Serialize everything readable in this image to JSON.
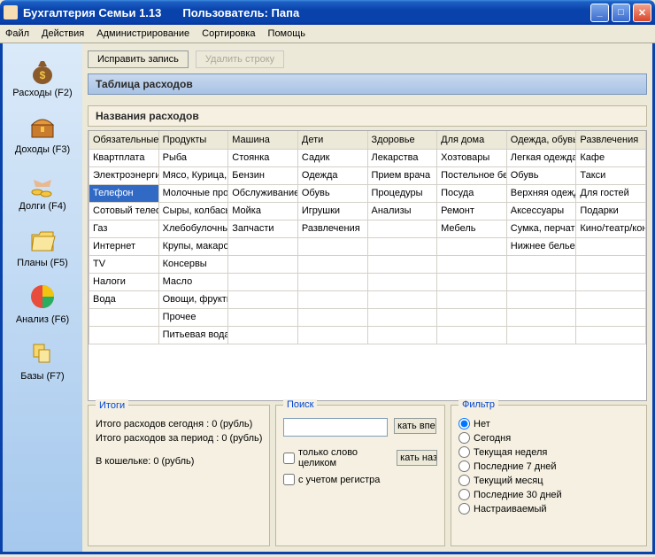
{
  "window": {
    "title": "Бухгалтерия Семьи 1.13",
    "user_prefix": "Пользователь:",
    "user_name": "Папа"
  },
  "menu": [
    "Файл",
    "Действия",
    "Администрирование",
    "Сортировка",
    "Помощь"
  ],
  "sidebar": [
    {
      "label": "Расходы (F2)",
      "icon": "money-bag-icon"
    },
    {
      "label": "Доходы (F3)",
      "icon": "chest-icon"
    },
    {
      "label": "Долги (F4)",
      "icon": "handshake-coins-icon"
    },
    {
      "label": "Планы (F5)",
      "icon": "folder-icon"
    },
    {
      "label": "Анализ (F6)",
      "icon": "pie-chart-icon"
    },
    {
      "label": "Базы (F7)",
      "icon": "database-folders-icon"
    }
  ],
  "toolbar": {
    "edit": "Исправить запись",
    "delete": "Удалить строку"
  },
  "headers": {
    "table": "Таблица расходов",
    "names": "Названия расходов"
  },
  "columns": [
    "Обязательные",
    "Продукты",
    "Машина",
    "Дети",
    "Здоровье",
    "Для дома",
    "Одежда, обувь",
    "Развлечения"
  ],
  "rows": [
    [
      "Квартплата",
      "Рыба",
      "Стоянка",
      "Садик",
      "Лекарства",
      "Хозтовары",
      "Легкая одежда",
      "Кафе"
    ],
    [
      "Электроэнергия",
      "Мясо, Курица,",
      "Бензин",
      "Одежда",
      "Прием врача",
      "Постельное белье",
      "Обувь",
      "Такси"
    ],
    [
      "Телефон",
      "Молочные про",
      "Обслуживание",
      "Обувь",
      "Процедуры",
      "Посуда",
      "Верхняя одежда",
      "Для гостей"
    ],
    [
      "Сотовый телефон",
      "Сыры, колбасы",
      "Мойка",
      "Игрушки",
      "Анализы",
      "Ремонт",
      "Аксессуары",
      "Подарки"
    ],
    [
      "Газ",
      "Хлебобулочные",
      "Запчасти",
      "Развлечения",
      "",
      "Мебель",
      "Сумка, перчатки",
      "Кино/театр/концерт"
    ],
    [
      "Интернет",
      "Крупы, макароны",
      "",
      "",
      "",
      "",
      "Нижнее белье",
      ""
    ],
    [
      "TV",
      "Консервы",
      "",
      "",
      "",
      "",
      "",
      ""
    ],
    [
      "Налоги",
      "Масло",
      "",
      "",
      "",
      "",
      "",
      ""
    ],
    [
      "Вода",
      "Овощи, фрукты",
      "",
      "",
      "",
      "",
      "",
      ""
    ],
    [
      "",
      "Прочее",
      "",
      "",
      "",
      "",
      "",
      ""
    ],
    [
      "",
      "Питьевая вода",
      "",
      "",
      "",
      "",
      "",
      ""
    ]
  ],
  "selected": {
    "row": 2,
    "col": 0
  },
  "totals": {
    "legend": "Итоги",
    "today": "Итого расходов сегодня : 0 (рубль)",
    "period": "Итого расходов за период : 0 (рубль)",
    "wallet": "В кошельке: 0 (рубль)"
  },
  "search": {
    "legend": "Поиск",
    "btn_fwd": "кать вперед",
    "btn_back": "кать назад",
    "whole_word": "только слово целиком",
    "match_case": "с учетом регистра"
  },
  "filter": {
    "legend": "Фильтр",
    "options": [
      "Нет",
      "Сегодня",
      "Текущая неделя",
      "Последние 7 дней",
      "Текущий месяц",
      "Последние 30 дней",
      "Настраиваемый"
    ],
    "selected": 0
  }
}
